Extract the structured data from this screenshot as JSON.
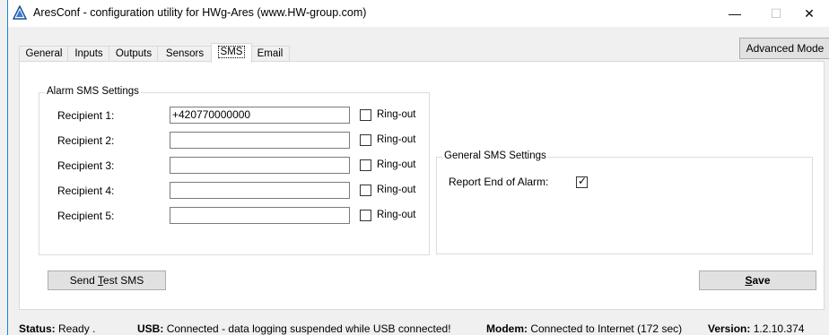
{
  "window": {
    "title": "AresConf - configuration utility for HWg-Ares (www.HW-group.com)",
    "minimize": "—",
    "maximize": "☐",
    "close": "✕",
    "advanced_mode": "Advanced Mode"
  },
  "tabs": [
    {
      "label": "General"
    },
    {
      "label": "Inputs"
    },
    {
      "label": "Outputs"
    },
    {
      "label": "Sensors"
    },
    {
      "label": "SMS"
    },
    {
      "label": "Email"
    }
  ],
  "alarm_sms": {
    "title": "Alarm SMS Settings",
    "recipients": [
      {
        "label": "Recipient 1:",
        "value": "+420770000000",
        "ringout_label": "Ring-out",
        "ringout": false
      },
      {
        "label": "Recipient 2:",
        "value": "",
        "ringout_label": "Ring-out",
        "ringout": false
      },
      {
        "label": "Recipient 3:",
        "value": "",
        "ringout_label": "Ring-out",
        "ringout": false
      },
      {
        "label": "Recipient 4:",
        "value": "",
        "ringout_label": "Ring-out",
        "ringout": false
      },
      {
        "label": "Recipient 5:",
        "value": "",
        "ringout_label": "Ring-out",
        "ringout": false
      }
    ]
  },
  "general_sms": {
    "title": "General SMS Settings",
    "report_end_label": "Report End of Alarm:",
    "report_end_checked": true
  },
  "buttons": {
    "send_test_prefix": "Send ",
    "send_test_underlined": "T",
    "send_test_suffix": "est SMS",
    "save_underlined": "S",
    "save_suffix": "ave"
  },
  "status": {
    "status_label": "Status:",
    "status_value": "Ready .",
    "usb_label": "USB:",
    "usb_value": "Connected - data logging suspended while USB connected!",
    "modem_label": "Modem:",
    "modem_value": "Connected to Internet (172 sec)",
    "version_label": "Version:",
    "version_value": "1.2.10.374"
  }
}
